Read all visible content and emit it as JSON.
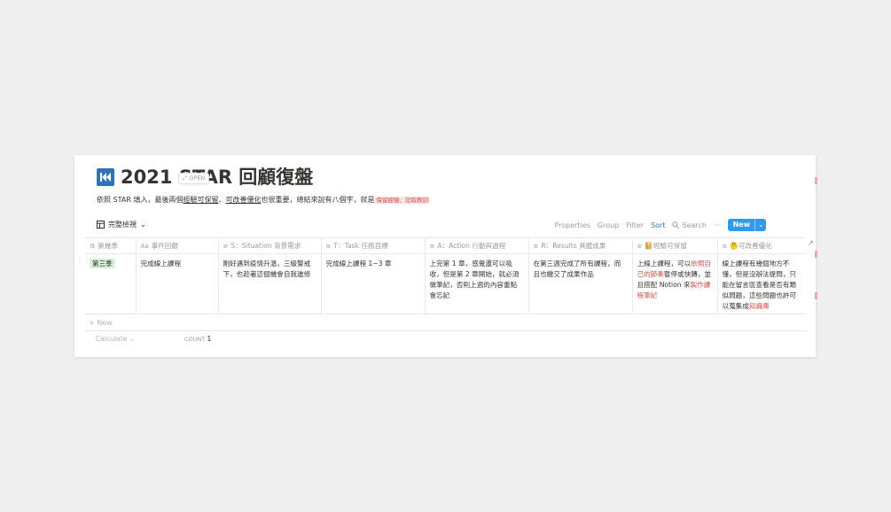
{
  "page": {
    "title": "2021 STAR 回顧復盤",
    "description_parts": [
      "依照 STAR 填入，最後兩個",
      "經驗可保留",
      "、",
      "可改善優化",
      "也很重要，總結來說有八個字，就是",
      "保留經驗、記取教訓"
    ]
  },
  "toolbar": {
    "view_name": "完整檢視",
    "properties": "Properties",
    "group": "Group",
    "filter": "Filter",
    "sort": "Sort",
    "search": "Search",
    "more": "···",
    "new": "New"
  },
  "table": {
    "columns": [
      {
        "icon": "gear-icon",
        "icon_char": "⚙",
        "label": "第幾季"
      },
      {
        "icon": "text-icon",
        "icon_char": "Aa",
        "label": "事件回顧"
      },
      {
        "icon": "lines-icon",
        "icon_char": "≡",
        "label": "S：Situation 背景需求"
      },
      {
        "icon": "lines-icon",
        "icon_char": "≡",
        "label": "T：Task 任務目標"
      },
      {
        "icon": "lines-icon",
        "icon_char": "≡",
        "label": "A：Action 行動與過程"
      },
      {
        "icon": "lines-icon",
        "icon_char": "≡",
        "label": "R：Results 具體成果"
      },
      {
        "icon": "lines-icon",
        "icon_char": "≡",
        "label": "📔經驗可保留"
      },
      {
        "icon": "lines-icon",
        "icon_char": "≡",
        "label": "🤔可改善優化"
      }
    ],
    "row": {
      "season": "第三季",
      "event": "完成線上課程",
      "open_label": "OPEN",
      "situation": "剛好遇到疫情升溫，三級警戒下，也趁著這個機會自我進修",
      "task": "完成線上課程 1~3 章",
      "action": "上完第 1 章，感覺還可以吸收，但是第 2 章開始，就必須做筆記，否則上週的內容重點會忘記",
      "results": "在第三週完成了所有課程，而且也繳交了成果作品",
      "keep_parts": [
        "上線上課程，可以",
        "依照自己的節奏",
        "暫停或快轉，並且搭配 Notion 來",
        "製作課程筆記"
      ],
      "improve_parts": [
        "線上課程有幾個地方不懂，但是沒辦法提問，只能在留言區查看是否有類似問題，這些問題也許可以蒐集成",
        "知識庫"
      ]
    },
    "add_new": "+ New",
    "calculate": "Calculate ⌄",
    "count_label": "COUNT",
    "count_value": "1"
  },
  "colors": {
    "accent_blue": "#2e9af0",
    "title_icon_blue": "#2e73b8",
    "highlight_red": "#d44c47",
    "season_tag_bg": "#dbeddb"
  }
}
